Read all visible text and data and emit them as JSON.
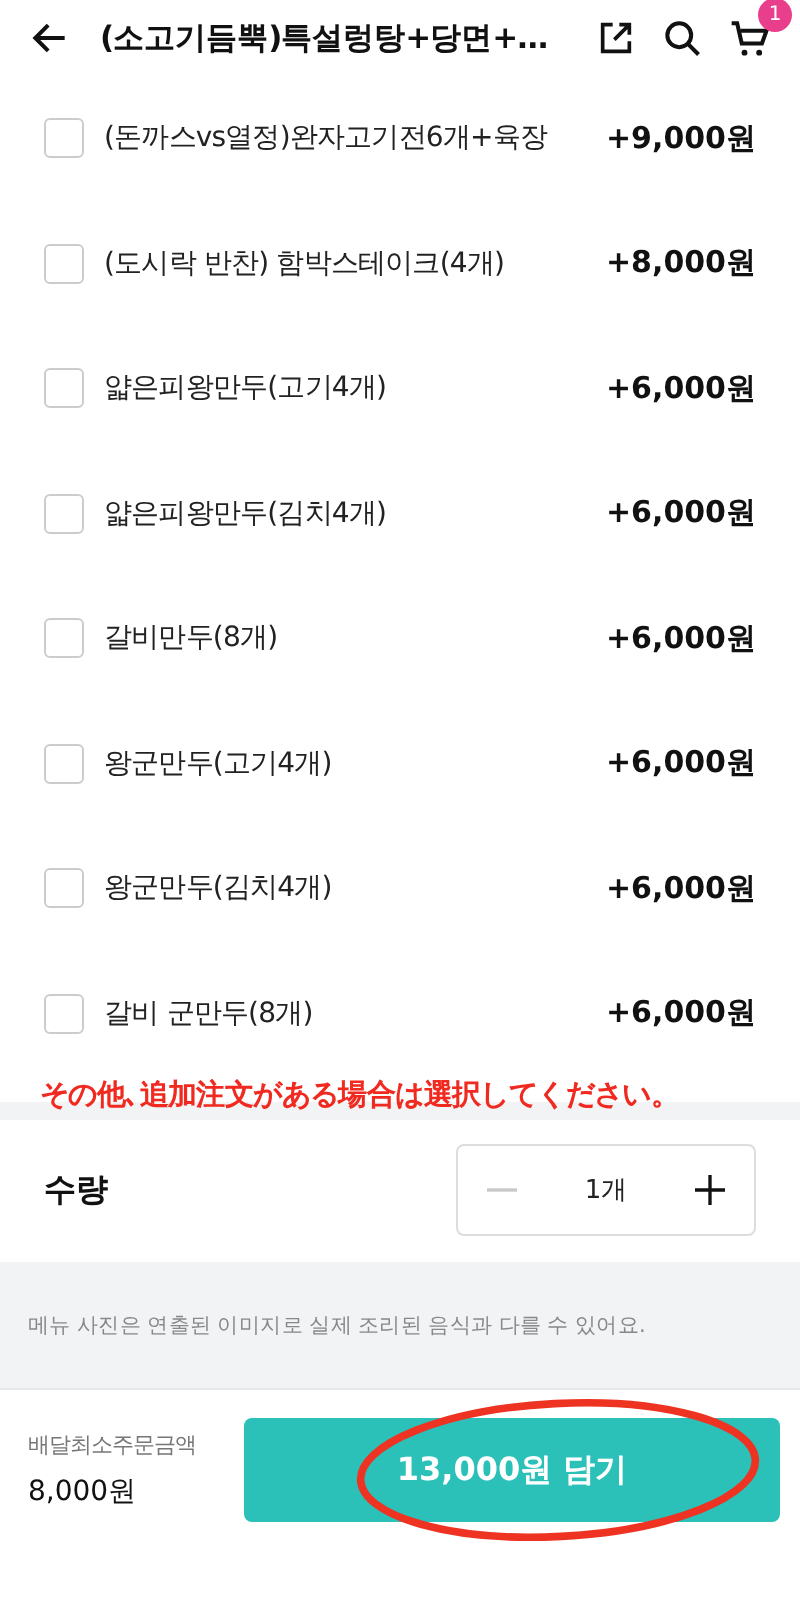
{
  "header": {
    "title": "(소고기듬뿍)특설렁탕+당면+…",
    "cart_count": "1"
  },
  "options": [
    {
      "label": "(돈까스vs열정)완자고기전6개+육장",
      "price": "+9,000원",
      "checked": false
    },
    {
      "label": "(도시락 반찬) 함박스테이크(4개)",
      "price": "+8,000원",
      "checked": false
    },
    {
      "label": "얇은피왕만두(고기4개)",
      "price": "+6,000원",
      "checked": false
    },
    {
      "label": "얇은피왕만두(김치4개)",
      "price": "+6,000원",
      "checked": false
    },
    {
      "label": "갈비만두(8개)",
      "price": "+6,000원",
      "checked": false
    },
    {
      "label": "왕군만두(고기4개)",
      "price": "+6,000원",
      "checked": false
    },
    {
      "label": "왕군만두(김치4개)",
      "price": "+6,000원",
      "checked": false
    },
    {
      "label": "갈비 군만두(8개)",
      "price": "+6,000원",
      "checked": false
    }
  ],
  "annotation_note": "その他､追加注文がある場合は選択してください。",
  "quantity": {
    "label": "수량",
    "value": "1개",
    "minus_disabled": true
  },
  "notice": "메뉴 사진은 연출된 이미지로 실제 조리된 음식과 다를 수 있어요.",
  "footer": {
    "min_order_label": "배달최소주문금액",
    "min_order_value": "8,000원",
    "add_button": "13,000원 담기",
    "button_circled": true
  }
}
